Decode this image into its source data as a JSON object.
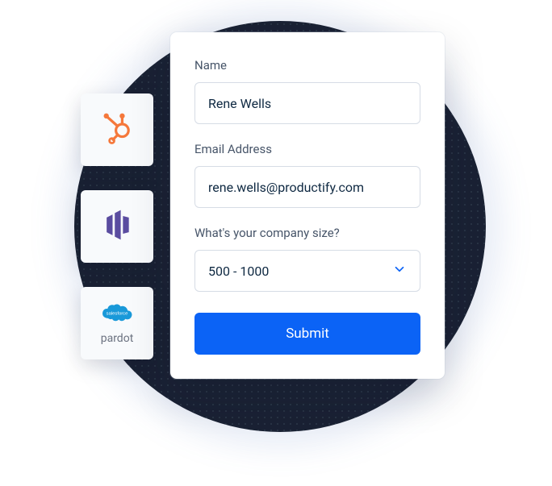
{
  "integrations": {
    "hubspot": {
      "name": "HubSpot"
    },
    "marketo": {
      "name": "Marketo"
    },
    "pardot": {
      "name": "Salesforce Pardot",
      "label": "pardot"
    }
  },
  "form": {
    "name": {
      "label": "Name",
      "value": "Rene Wells"
    },
    "email": {
      "label": "Email Address",
      "value": "rene.wells@productify.com"
    },
    "company_size": {
      "label": "What's your company size?",
      "value": "500 - 1000"
    },
    "submit_label": "Submit"
  }
}
